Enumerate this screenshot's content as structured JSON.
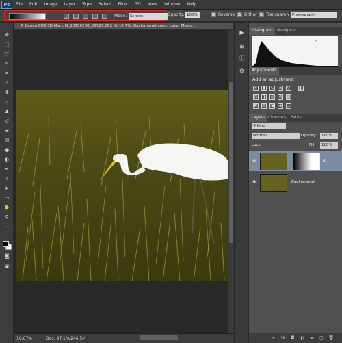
{
  "app": {
    "logo": "Ps"
  },
  "menu": [
    "File",
    "Edit",
    "Image",
    "Layer",
    "Type",
    "Select",
    "Filter",
    "3D",
    "View",
    "Window",
    "Help"
  ],
  "options_bar": {
    "mode_label": "Mode:",
    "mode_value": "Screen",
    "opacity_label": "Opacity:",
    "opacity_value": "100%",
    "reverse_label": "Reverse",
    "dither_label": "Dither",
    "transparency_label": "Transparen",
    "workspace_value": "Photography"
  },
  "document": {
    "tab_title": "© Canon EOS 5D Mark III_20150208_80727.CR2 @ 16.7% (Background copy, Layer Mask/...",
    "zoom": "16.67%",
    "doc_size": "Doc: 97.1M/246.5M"
  },
  "panels": {
    "histogram_tabs": [
      "Histogram",
      "Navigator"
    ],
    "adjustments_tab": "Adjustments",
    "adjustments_title": "Add an adjustment",
    "layers_tabs": [
      "Layers",
      "Channels",
      "Paths"
    ],
    "kind_filter": "Kind",
    "blend_mode": "Normal",
    "opacity_label": "Opacity:",
    "opacity_value": "100%",
    "lock_label": "Lock:",
    "fill_label": "Fill:",
    "fill_value": "100%",
    "layers": [
      {
        "name": "B..."
      },
      {
        "name": "Background"
      }
    ]
  },
  "colors": {
    "accent_highlight": "#e0291e",
    "selected_layer": "#7c8ba0",
    "grass_dark": "#3e3f0f",
    "grass_light": "#8c8a2c"
  }
}
